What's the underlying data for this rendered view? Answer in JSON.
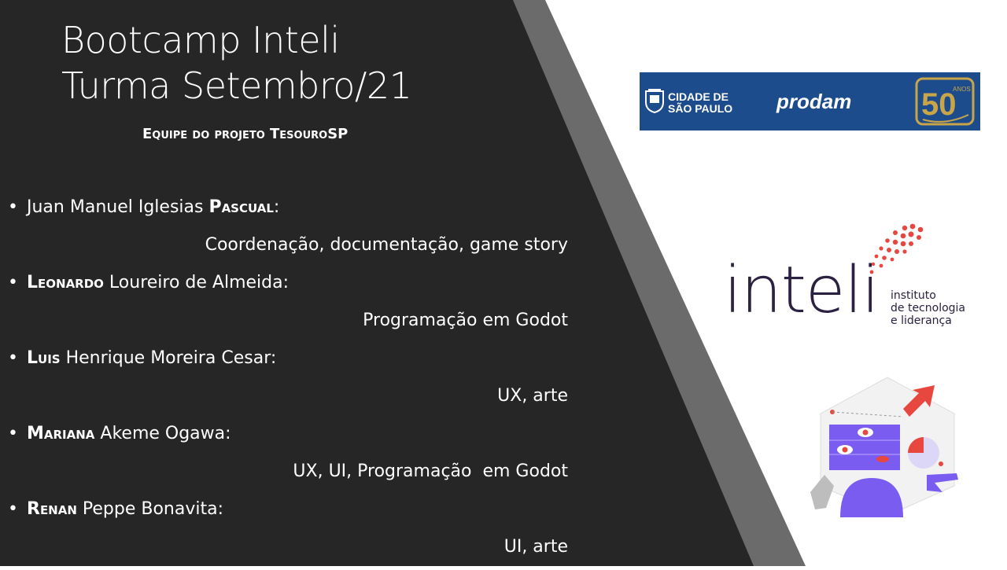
{
  "slide": {
    "title_line1": "Bootcamp Inteli",
    "title_line2": "Turma Setembro/21",
    "subtitle": "Equipe do projeto TesouroSP"
  },
  "members": [
    {
      "bold": "",
      "name_rest": "Juan Manuel Iglesias ",
      "bold_after": "Pascual",
      "suffix": ":",
      "role": "Coordenação, documentação, game story"
    },
    {
      "bold": "Leonardo",
      "name_rest": " Loureiro de Almeida:",
      "bold_after": "",
      "suffix": "",
      "role": "Programação em Godot"
    },
    {
      "bold": "Luis",
      "name_rest": " Henrique Moreira Cesar:",
      "bold_after": "",
      "suffix": "",
      "role": "UX, arte"
    },
    {
      "bold": "Mariana",
      "name_rest": " Akeme Ogawa:",
      "bold_after": "",
      "suffix": "",
      "role": "UX, UI, Programação  em Godot"
    },
    {
      "bold": "Renan",
      "name_rest": " Peppe Bonavita:",
      "bold_after": "",
      "suffix": "",
      "role": "UI, arte"
    }
  ],
  "logos": {
    "prodam": {
      "cidade_line1": "CIDADE DE",
      "cidade_line2": "SÃO PAULO",
      "brand": "prodam",
      "anniversary": "50 ANOS"
    },
    "inteli": {
      "word": "inteli",
      "tag_line1": "instituto",
      "tag_line2": "de tecnologia",
      "tag_line3": "e liderança"
    }
  },
  "colors": {
    "dark_panel": "#262626",
    "stripe": "#6b6b6b",
    "prodam_blue": "#1d4c8c",
    "inteli_red": "#e8473f",
    "inteli_navy": "#2b2140",
    "illustration_purple": "#7a5cf0"
  }
}
